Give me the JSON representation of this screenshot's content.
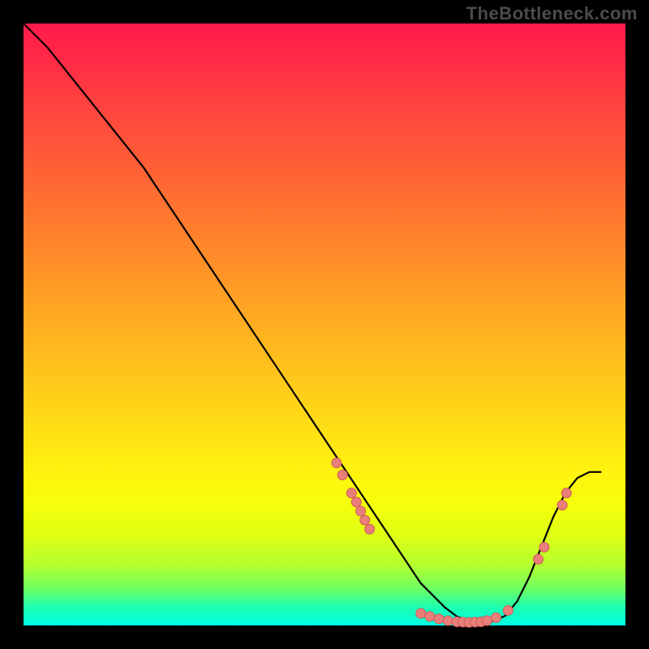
{
  "watermark": "TheBottleneck.com",
  "colors": {
    "background": "#000000",
    "curve": "#000000",
    "marker_fill": "#e87f7b",
    "marker_stroke": "#d15a56",
    "gradient_top": "#ff1b4b",
    "gradient_bottom": "#00ffe5"
  },
  "chart_data": {
    "type": "line",
    "title": "",
    "xlabel": "",
    "ylabel": "",
    "xlim": [
      0,
      100
    ],
    "ylim": [
      0,
      100
    ],
    "curve": {
      "x": [
        0,
        4,
        8,
        12,
        16,
        20,
        24,
        28,
        32,
        36,
        40,
        44,
        48,
        52,
        56,
        60,
        62,
        64,
        66,
        68,
        70,
        72,
        74,
        76,
        78,
        80,
        82,
        84,
        86,
        88,
        90,
        92,
        94,
        96
      ],
      "y": [
        100,
        96,
        91,
        86,
        81,
        76,
        70,
        64,
        58,
        52,
        46,
        40,
        34,
        28,
        22,
        16,
        13,
        10,
        7,
        5,
        3,
        1.5,
        0.7,
        0.5,
        0.7,
        1.6,
        4,
        8,
        13,
        18,
        22,
        24.5,
        25.5,
        25.5
      ]
    },
    "markers": [
      {
        "x": 52.0,
        "y": 27
      },
      {
        "x": 53.0,
        "y": 25
      },
      {
        "x": 54.5,
        "y": 22
      },
      {
        "x": 55.3,
        "y": 20.5
      },
      {
        "x": 56.0,
        "y": 19
      },
      {
        "x": 56.7,
        "y": 17.5
      },
      {
        "x": 57.5,
        "y": 16
      },
      {
        "x": 66.0,
        "y": 2
      },
      {
        "x": 67.5,
        "y": 1.5
      },
      {
        "x": 69.0,
        "y": 1.1
      },
      {
        "x": 70.5,
        "y": 0.8
      },
      {
        "x": 72.0,
        "y": 0.6
      },
      {
        "x": 73.0,
        "y": 0.55
      },
      {
        "x": 74.0,
        "y": 0.5
      },
      {
        "x": 75.0,
        "y": 0.55
      },
      {
        "x": 76.0,
        "y": 0.6
      },
      {
        "x": 77.0,
        "y": 0.8
      },
      {
        "x": 78.5,
        "y": 1.3
      },
      {
        "x": 80.5,
        "y": 2.5
      },
      {
        "x": 85.5,
        "y": 11
      },
      {
        "x": 86.5,
        "y": 13
      },
      {
        "x": 89.5,
        "y": 20
      },
      {
        "x": 90.2,
        "y": 22
      }
    ]
  }
}
